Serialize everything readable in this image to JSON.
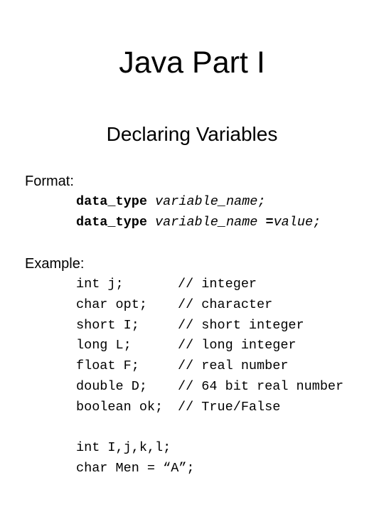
{
  "title": "Java Part I",
  "subtitle": "Declaring Variables",
  "format": {
    "label": "Format:",
    "lines": [
      {
        "type": "data_type",
        "name": "variable_name",
        "suffix": ";"
      },
      {
        "type": "data_type",
        "name": "variable_name",
        "assign": " =",
        "value": "value",
        "suffix": ";"
      }
    ]
  },
  "example": {
    "label": "Example:",
    "rows": [
      {
        "code": "int j;",
        "comment": "// integer"
      },
      {
        "code": "char opt;",
        "comment": "// character"
      },
      {
        "code": "short I;",
        "comment": "// short integer"
      },
      {
        "code": "long L;",
        "comment": "// long integer"
      },
      {
        "code": "float F;",
        "comment": "// real number"
      },
      {
        "code": "double D;",
        "comment": "// 64 bit real number"
      },
      {
        "code": "boolean ok;",
        "comment": "// True/False"
      }
    ],
    "extra": [
      "int I,j,k,l;",
      "char Men = “A”;"
    ]
  }
}
